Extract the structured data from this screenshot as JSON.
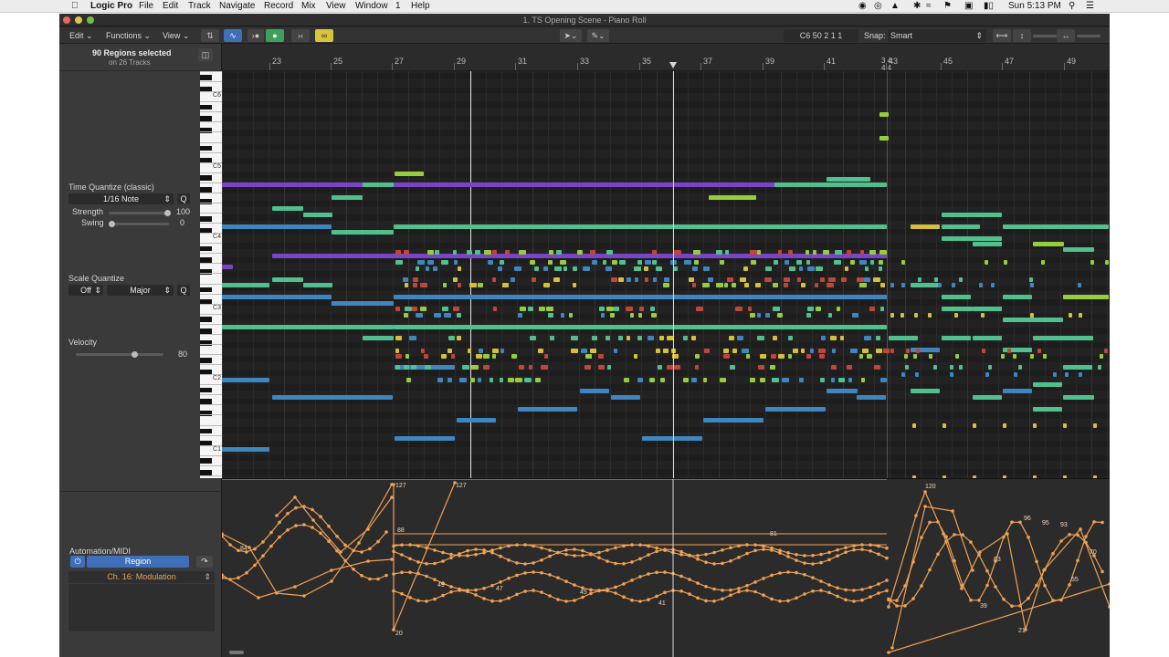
{
  "menubar": {
    "items": [
      "Logic Pro",
      "File",
      "Edit",
      "Track",
      "Navigate",
      "Record",
      "Mix",
      "View",
      "Window",
      "1",
      "Help"
    ],
    "clock": "Sun 5:13 PM"
  },
  "window": {
    "title": "1. TS Opening Scene - Piano Roll"
  },
  "toolbar": {
    "edit": "Edit",
    "functions": "Functions",
    "view": "View",
    "position": "C6  50 2 1 1",
    "snap_label": "Snap:",
    "snap_value": "Smart"
  },
  "inspector": {
    "selection_title": "90 Regions selected",
    "selection_sub": "on 26 Tracks",
    "time_quantize": {
      "title": "Time Quantize (classic)",
      "value": "1/16 Note",
      "q": "Q",
      "strength_label": "Strength",
      "strength_value": "100",
      "strength_level": 1.0,
      "swing_label": "Swing",
      "swing_value": "0",
      "swing_level": 0.0
    },
    "scale_quantize": {
      "title": "Scale Quantize",
      "root": "Off",
      "scale": "Major",
      "q": "Q"
    },
    "velocity": {
      "title": "Velocity",
      "value": "80",
      "level": 0.63
    },
    "automation": {
      "title": "Automation/MIDI",
      "mode": "Region",
      "param": "Ch. 16: Modulation"
    }
  },
  "keyboard": {
    "labels": [
      "C6",
      "C5",
      "C4",
      "C3",
      "C2",
      "C1"
    ]
  },
  "ruler": {
    "bars": [
      "23",
      "25",
      "27",
      "29",
      "31",
      "33",
      "35",
      "37",
      "39",
      "41",
      "43",
      "45",
      "47",
      "49"
    ],
    "sig_top": "3  4",
    "sig_bottom": "4  4"
  },
  "automation_values": [
    "127",
    "127",
    "120",
    "88",
    "84",
    "81",
    "96",
    "95",
    "93",
    "47",
    "49",
    "45",
    "41",
    "39",
    "21",
    "20",
    "55",
    "70",
    "63"
  ],
  "colors": {
    "purple": "#7a44c8",
    "blue": "#3f86c0",
    "green": "#51c08f",
    "lime": "#96cc3e",
    "red": "#c0453b",
    "yellow": "#d6c03a",
    "automation": "#f0a154"
  }
}
